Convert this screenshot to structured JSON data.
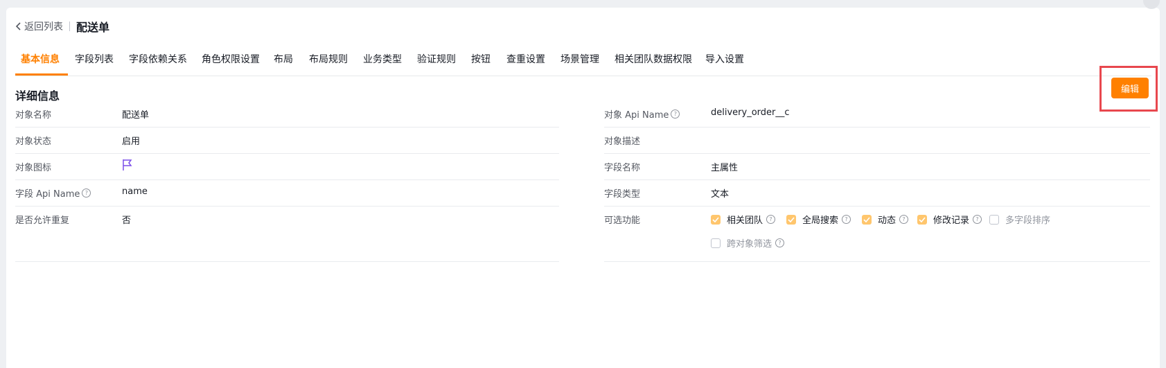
{
  "header": {
    "back_label": "返回列表",
    "title": "配送单"
  },
  "tabs": [
    {
      "label": "基本信息",
      "active": true
    },
    {
      "label": "字段列表"
    },
    {
      "label": "字段依赖关系"
    },
    {
      "label": "角色权限设置"
    },
    {
      "label": "布局"
    },
    {
      "label": "布局规则"
    },
    {
      "label": "业务类型"
    },
    {
      "label": "验证规则"
    },
    {
      "label": "按钮"
    },
    {
      "label": "查重设置"
    },
    {
      "label": "场景管理"
    },
    {
      "label": "相关团队数据权限"
    },
    {
      "label": "导入设置"
    }
  ],
  "section": {
    "title": "详细信息",
    "edit_label": "编辑"
  },
  "left_fields": [
    {
      "label": "对象名称",
      "value": "配送单"
    },
    {
      "label": "对象状态",
      "value": "启用"
    },
    {
      "label": "对象图标",
      "value": ""
    },
    {
      "label": "字段 Api Name",
      "value": "name"
    },
    {
      "label": "是否允许重复",
      "value": "否"
    }
  ],
  "right_fields": [
    {
      "label": "对象 Api Name",
      "value": "delivery_order__c"
    },
    {
      "label": "对象描述",
      "value": ""
    },
    {
      "label": "字段名称",
      "value": "主属性"
    },
    {
      "label": "字段类型",
      "value": "文本"
    },
    {
      "label": "可选功能",
      "value": ""
    }
  ],
  "options": [
    {
      "label": "相关团队",
      "checked": true
    },
    {
      "label": "全局搜索",
      "checked": true
    },
    {
      "label": "动态",
      "checked": true
    },
    {
      "label": "修改记录",
      "checked": true
    },
    {
      "label": "多字段排序",
      "checked": false
    },
    {
      "label": "跨对象筛选",
      "checked": false
    }
  ],
  "help_glyph": "?",
  "colors": {
    "accent": "#ff8000",
    "highlight_box": "#e8474e",
    "checkbox_on": "#ffc66d",
    "icon_purple": "#7b4ee8"
  }
}
